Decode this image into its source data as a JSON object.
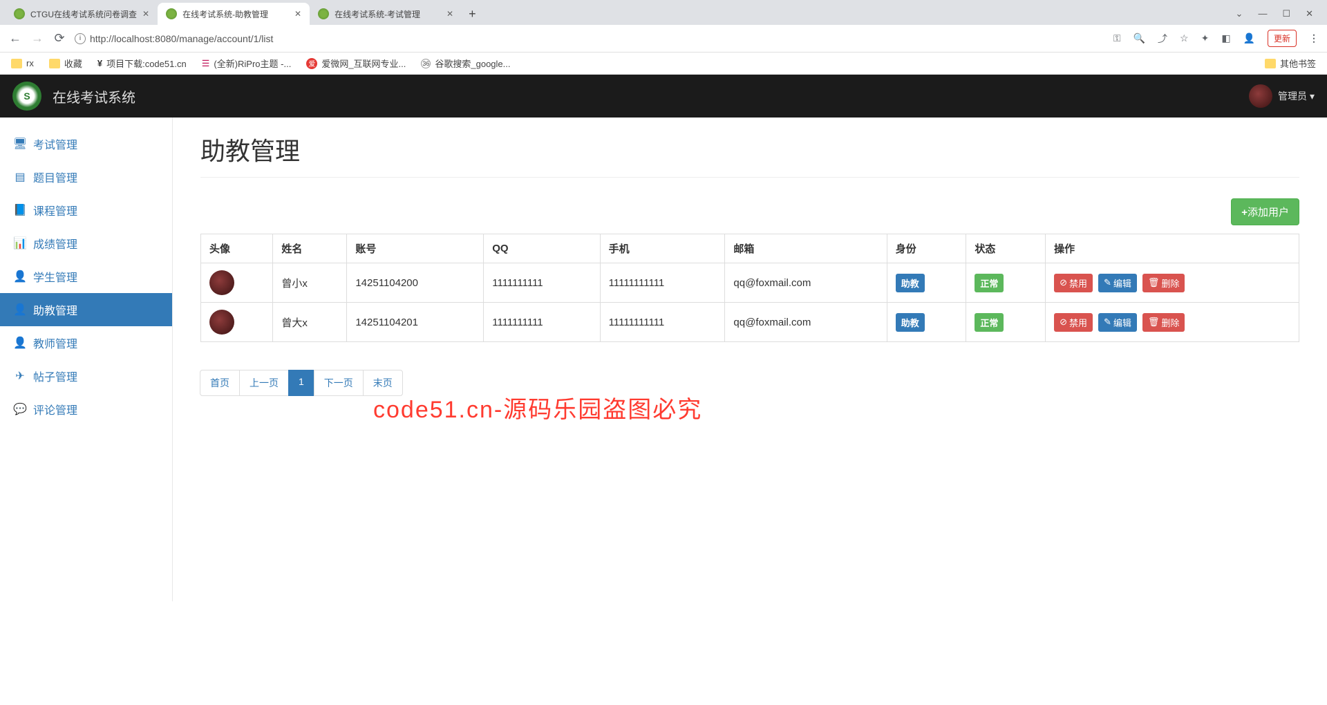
{
  "browser": {
    "tabs": [
      {
        "title": "CTGU在线考试系统问卷调查"
      },
      {
        "title": "在线考试系统-助教管理"
      },
      {
        "title": "在线考试系统-考试管理"
      }
    ],
    "url": "http://localhost:8080/manage/account/1/list",
    "update_label": "更新",
    "bookmarks": [
      "rx",
      "收藏",
      "项目下载:code51.cn",
      "(全新)RiPro主题 -...",
      "爱微网_互联网专业...",
      "谷歌搜索_google..."
    ],
    "other_bookmarks": "其他书签"
  },
  "app": {
    "brand": "在线考试系统",
    "username": "管理员"
  },
  "sidebar": {
    "items": [
      {
        "label": "考试管理",
        "icon": "🖥"
      },
      {
        "label": "题目管理",
        "icon": "▤"
      },
      {
        "label": "课程管理",
        "icon": "📘"
      },
      {
        "label": "成绩管理",
        "icon": "📊"
      },
      {
        "label": "学生管理",
        "icon": "👤"
      },
      {
        "label": "助教管理",
        "icon": "👤"
      },
      {
        "label": "教师管理",
        "icon": "👤"
      },
      {
        "label": "帖子管理",
        "icon": "✈"
      },
      {
        "label": "评论管理",
        "icon": "💬"
      }
    ]
  },
  "page": {
    "title": "助教管理",
    "add_user": "添加用户",
    "columns": [
      "头像",
      "姓名",
      "账号",
      "QQ",
      "手机",
      "邮箱",
      "身份",
      "状态",
      "操作"
    ],
    "rows": [
      {
        "name": "曾小x",
        "account": "14251104200",
        "qq": "1111111111",
        "phone": "11111111111",
        "email": "qq@foxmail.com",
        "role": "助教",
        "status": "正常"
      },
      {
        "name": "曾大x",
        "account": "14251104201",
        "qq": "1111111111",
        "phone": "11111111111",
        "email": "qq@foxmail.com",
        "role": "助教",
        "status": "正常"
      }
    ],
    "actions": {
      "disable": "禁用",
      "edit": "编辑",
      "delete": "删除"
    },
    "pagination": {
      "first": "首页",
      "prev": "上一页",
      "current": "1",
      "next": "下一页",
      "last": "末页"
    }
  },
  "watermark": "code51.cn-源码乐园盗图必究"
}
